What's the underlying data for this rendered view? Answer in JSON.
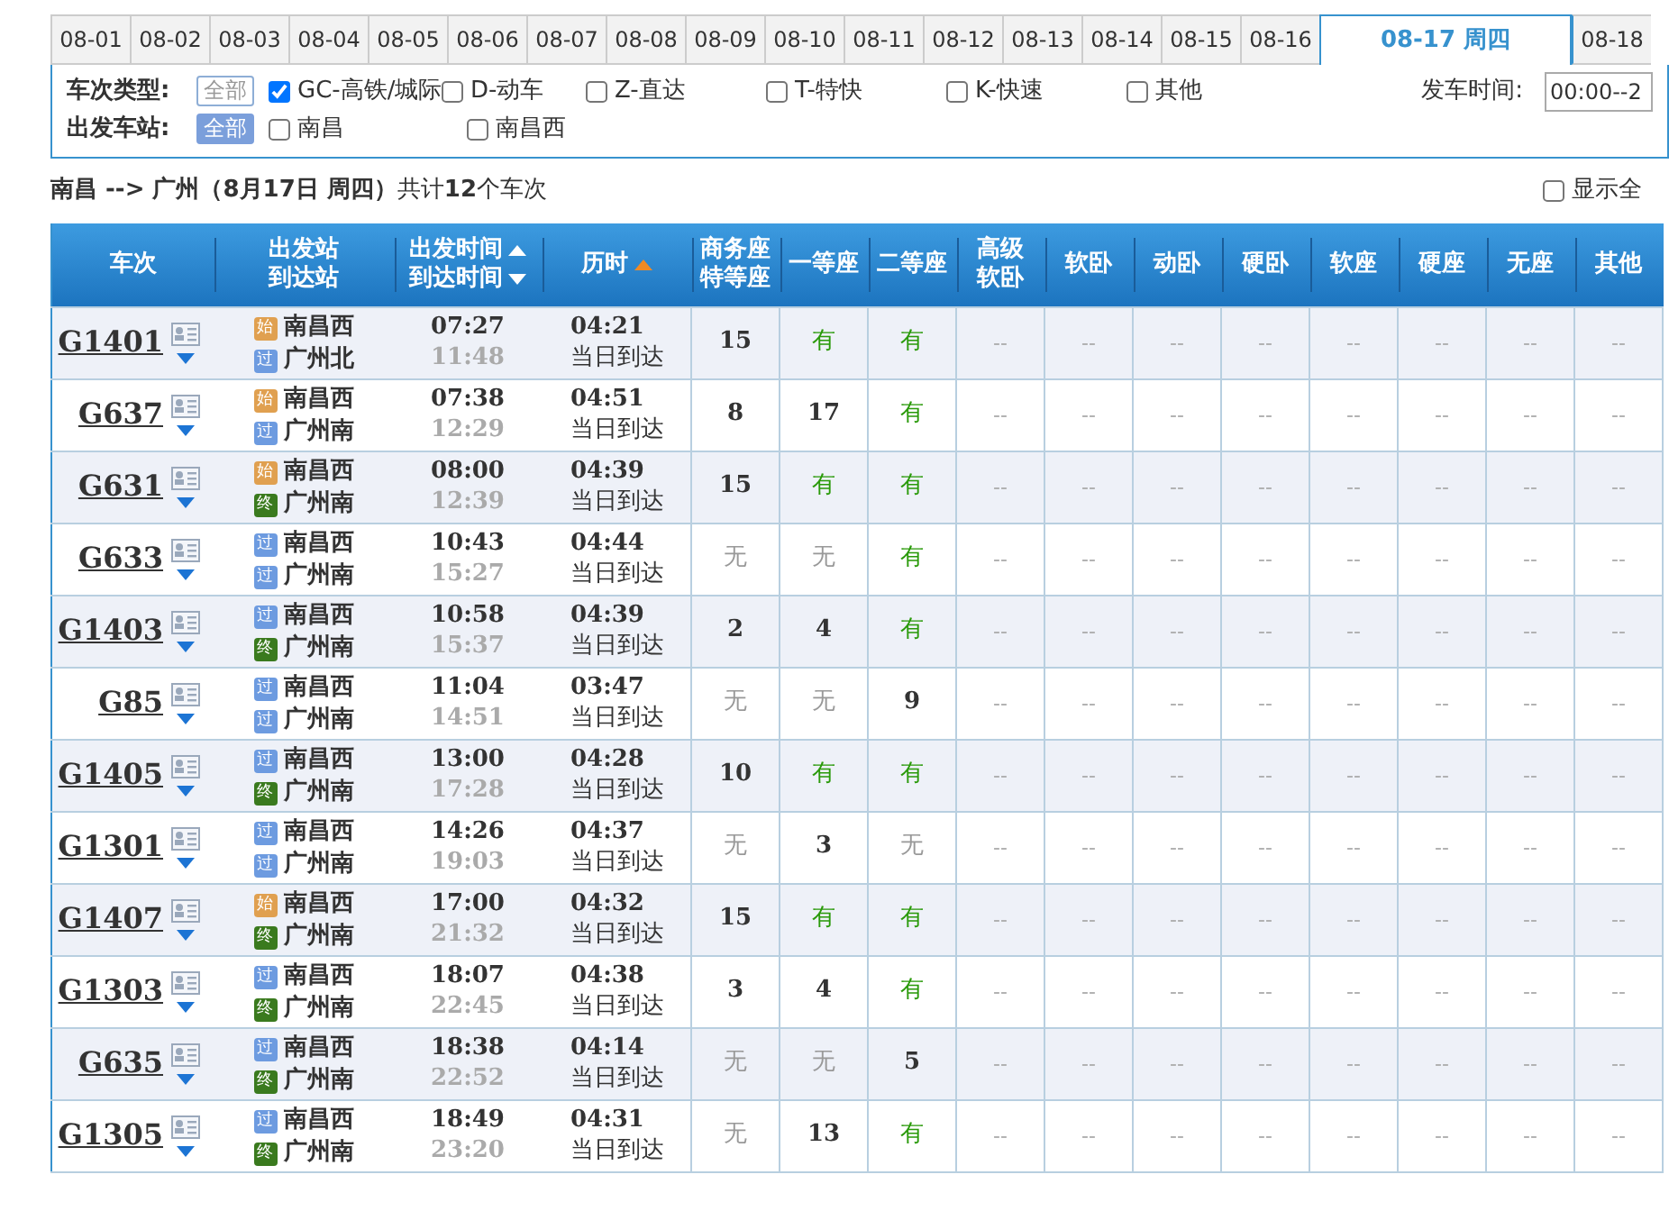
{
  "date_tabs": [
    {
      "label": "08-01",
      "selected": false
    },
    {
      "label": "08-02",
      "selected": false
    },
    {
      "label": "08-03",
      "selected": false
    },
    {
      "label": "08-04",
      "selected": false
    },
    {
      "label": "08-05",
      "selected": false
    },
    {
      "label": "08-06",
      "selected": false
    },
    {
      "label": "08-07",
      "selected": false
    },
    {
      "label": "08-08",
      "selected": false
    },
    {
      "label": "08-09",
      "selected": false
    },
    {
      "label": "08-10",
      "selected": false
    },
    {
      "label": "08-11",
      "selected": false
    },
    {
      "label": "08-12",
      "selected": false
    },
    {
      "label": "08-13",
      "selected": false
    },
    {
      "label": "08-14",
      "selected": false
    },
    {
      "label": "08-15",
      "selected": false
    },
    {
      "label": "08-16",
      "selected": false
    },
    {
      "label": "08-17 周四",
      "selected": true
    },
    {
      "label": "08-18",
      "selected": false
    }
  ],
  "filters": {
    "train_type": {
      "label": "车次类型:",
      "all": {
        "label": "全部",
        "selected": false
      },
      "options": [
        {
          "label": "GC-高铁/城际",
          "checked": true
        },
        {
          "label": "D-动车",
          "checked": false
        },
        {
          "label": "Z-直达",
          "checked": false
        },
        {
          "label": "T-特快",
          "checked": false
        },
        {
          "label": "K-快速",
          "checked": false
        },
        {
          "label": "其他",
          "checked": false
        }
      ]
    },
    "departure_time": {
      "label": "发车时间:",
      "value": "00:00--2"
    },
    "station": {
      "label": "出发车站:",
      "all": {
        "label": "全部",
        "selected": true
      },
      "options": [
        {
          "label": "南昌",
          "checked": false
        },
        {
          "label": "南昌西",
          "checked": false
        }
      ]
    }
  },
  "summary": {
    "text": "**南昌 --> 广州（8月17日  周四）**共计**12**个车次",
    "show_all": {
      "label": "显示全",
      "checked": false
    }
  },
  "table": {
    "columns": [
      {
        "lines": [
          "车次"
        ]
      },
      {
        "lines": [
          "出发站",
          "到达站"
        ]
      },
      {
        "lines": [
          "出发时间",
          "到达时间"
        ],
        "sort_up": true,
        "sort_down": true
      },
      {
        "lines": [
          "历时"
        ],
        "sort_up": true,
        "sort_active": true
      },
      {
        "lines": [
          "商务座",
          "特等座"
        ]
      },
      {
        "lines": [
          "一等座"
        ]
      },
      {
        "lines": [
          "二等座"
        ]
      },
      {
        "lines": [
          "高级",
          "软卧"
        ]
      },
      {
        "lines": [
          "软卧"
        ]
      },
      {
        "lines": [
          "动卧"
        ]
      },
      {
        "lines": [
          "硬卧"
        ]
      },
      {
        "lines": [
          "软座"
        ]
      },
      {
        "lines": [
          "硬座"
        ]
      },
      {
        "lines": [
          "无座"
        ]
      },
      {
        "lines": [
          "其他"
        ]
      }
    ],
    "rows": [
      {
        "train": "G1401",
        "from": {
          "tag": "始",
          "kind": "start",
          "name": "南昌西"
        },
        "to": {
          "tag": "过",
          "kind": "pass",
          "name": "广州北"
        },
        "depart": "07:27",
        "arrive": "11:48",
        "duration": "04:21",
        "arrival_day": "当日到达",
        "seats": [
          {
            "text": "15",
            "kind": "count"
          },
          {
            "text": "有",
            "kind": "available"
          },
          {
            "text": "有",
            "kind": "available"
          }
        ],
        "other_seats": [
          "--",
          "--",
          "--",
          "--",
          "--",
          "--",
          "--",
          "--"
        ]
      },
      {
        "train": "G637",
        "from": {
          "tag": "始",
          "kind": "start",
          "name": "南昌西"
        },
        "to": {
          "tag": "过",
          "kind": "pass",
          "name": "广州南"
        },
        "depart": "07:38",
        "arrive": "12:29",
        "duration": "04:51",
        "arrival_day": "当日到达",
        "seats": [
          {
            "text": "8",
            "kind": "count"
          },
          {
            "text": "17",
            "kind": "count"
          },
          {
            "text": "有",
            "kind": "available"
          }
        ],
        "other_seats": [
          "--",
          "--",
          "--",
          "--",
          "--",
          "--",
          "--",
          "--"
        ]
      },
      {
        "train": "G631",
        "from": {
          "tag": "始",
          "kind": "start",
          "name": "南昌西"
        },
        "to": {
          "tag": "终",
          "kind": "end",
          "name": "广州南"
        },
        "depart": "08:00",
        "arrive": "12:39",
        "duration": "04:39",
        "arrival_day": "当日到达",
        "seats": [
          {
            "text": "15",
            "kind": "count"
          },
          {
            "text": "有",
            "kind": "available"
          },
          {
            "text": "有",
            "kind": "available"
          }
        ],
        "other_seats": [
          "--",
          "--",
          "--",
          "--",
          "--",
          "--",
          "--",
          "--"
        ]
      },
      {
        "train": "G633",
        "from": {
          "tag": "过",
          "kind": "pass",
          "name": "南昌西"
        },
        "to": {
          "tag": "过",
          "kind": "pass",
          "name": "广州南"
        },
        "depart": "10:43",
        "arrive": "15:27",
        "duration": "04:44",
        "arrival_day": "当日到达",
        "seats": [
          {
            "text": "无",
            "kind": "none"
          },
          {
            "text": "无",
            "kind": "none"
          },
          {
            "text": "有",
            "kind": "available"
          }
        ],
        "other_seats": [
          "--",
          "--",
          "--",
          "--",
          "--",
          "--",
          "--",
          "--"
        ]
      },
      {
        "train": "G1403",
        "from": {
          "tag": "过",
          "kind": "pass",
          "name": "南昌西"
        },
        "to": {
          "tag": "终",
          "kind": "end",
          "name": "广州南"
        },
        "depart": "10:58",
        "arrive": "15:37",
        "duration": "04:39",
        "arrival_day": "当日到达",
        "seats": [
          {
            "text": "2",
            "kind": "count"
          },
          {
            "text": "4",
            "kind": "count"
          },
          {
            "text": "有",
            "kind": "available"
          }
        ],
        "other_seats": [
          "--",
          "--",
          "--",
          "--",
          "--",
          "--",
          "--",
          "--"
        ]
      },
      {
        "train": "G85",
        "from": {
          "tag": "过",
          "kind": "pass",
          "name": "南昌西"
        },
        "to": {
          "tag": "过",
          "kind": "pass",
          "name": "广州南"
        },
        "depart": "11:04",
        "arrive": "14:51",
        "duration": "03:47",
        "arrival_day": "当日到达",
        "seats": [
          {
            "text": "无",
            "kind": "none"
          },
          {
            "text": "无",
            "kind": "none"
          },
          {
            "text": "9",
            "kind": "count"
          }
        ],
        "other_seats": [
          "--",
          "--",
          "--",
          "--",
          "--",
          "--",
          "--",
          "--"
        ]
      },
      {
        "train": "G1405",
        "from": {
          "tag": "过",
          "kind": "pass",
          "name": "南昌西"
        },
        "to": {
          "tag": "终",
          "kind": "end",
          "name": "广州南"
        },
        "depart": "13:00",
        "arrive": "17:28",
        "duration": "04:28",
        "arrival_day": "当日到达",
        "seats": [
          {
            "text": "10",
            "kind": "count"
          },
          {
            "text": "有",
            "kind": "available"
          },
          {
            "text": "有",
            "kind": "available"
          }
        ],
        "other_seats": [
          "--",
          "--",
          "--",
          "--",
          "--",
          "--",
          "--",
          "--"
        ]
      },
      {
        "train": "G1301",
        "from": {
          "tag": "过",
          "kind": "pass",
          "name": "南昌西"
        },
        "to": {
          "tag": "过",
          "kind": "pass",
          "name": "广州南"
        },
        "depart": "14:26",
        "arrive": "19:03",
        "duration": "04:37",
        "arrival_day": "当日到达",
        "seats": [
          {
            "text": "无",
            "kind": "none"
          },
          {
            "text": "3",
            "kind": "count"
          },
          {
            "text": "无",
            "kind": "none"
          }
        ],
        "other_seats": [
          "--",
          "--",
          "--",
          "--",
          "--",
          "--",
          "--",
          "--"
        ]
      },
      {
        "train": "G1407",
        "from": {
          "tag": "始",
          "kind": "start",
          "name": "南昌西"
        },
        "to": {
          "tag": "终",
          "kind": "end",
          "name": "广州南"
        },
        "depart": "17:00",
        "arrive": "21:32",
        "duration": "04:32",
        "arrival_day": "当日到达",
        "seats": [
          {
            "text": "15",
            "kind": "count"
          },
          {
            "text": "有",
            "kind": "available"
          },
          {
            "text": "有",
            "kind": "available"
          }
        ],
        "other_seats": [
          "--",
          "--",
          "--",
          "--",
          "--",
          "--",
          "--",
          "--"
        ]
      },
      {
        "train": "G1303",
        "from": {
          "tag": "过",
          "kind": "pass",
          "name": "南昌西"
        },
        "to": {
          "tag": "终",
          "kind": "end",
          "name": "广州南"
        },
        "depart": "18:07",
        "arrive": "22:45",
        "duration": "04:38",
        "arrival_day": "当日到达",
        "seats": [
          {
            "text": "3",
            "kind": "count"
          },
          {
            "text": "4",
            "kind": "count"
          },
          {
            "text": "有",
            "kind": "available"
          }
        ],
        "other_seats": [
          "--",
          "--",
          "--",
          "--",
          "--",
          "--",
          "--",
          "--"
        ]
      },
      {
        "train": "G635",
        "from": {
          "tag": "过",
          "kind": "pass",
          "name": "南昌西"
        },
        "to": {
          "tag": "终",
          "kind": "end",
          "name": "广州南"
        },
        "depart": "18:38",
        "arrive": "22:52",
        "duration": "04:14",
        "arrival_day": "当日到达",
        "seats": [
          {
            "text": "无",
            "kind": "none"
          },
          {
            "text": "无",
            "kind": "none"
          },
          {
            "text": "5",
            "kind": "count"
          }
        ],
        "other_seats": [
          "--",
          "--",
          "--",
          "--",
          "--",
          "--",
          "--",
          "--"
        ]
      },
      {
        "train": "G1305",
        "from": {
          "tag": "过",
          "kind": "pass",
          "name": "南昌西"
        },
        "to": {
          "tag": "终",
          "kind": "end",
          "name": "广州南"
        },
        "depart": "18:49",
        "arrive": "23:20",
        "duration": "04:31",
        "arrival_day": "当日到达",
        "seats": [
          {
            "text": "无",
            "kind": "none"
          },
          {
            "text": "13",
            "kind": "count"
          },
          {
            "text": "有",
            "kind": "available"
          }
        ],
        "other_seats": [
          "--",
          "--",
          "--",
          "--",
          "--",
          "--",
          "--",
          "--"
        ]
      }
    ]
  }
}
